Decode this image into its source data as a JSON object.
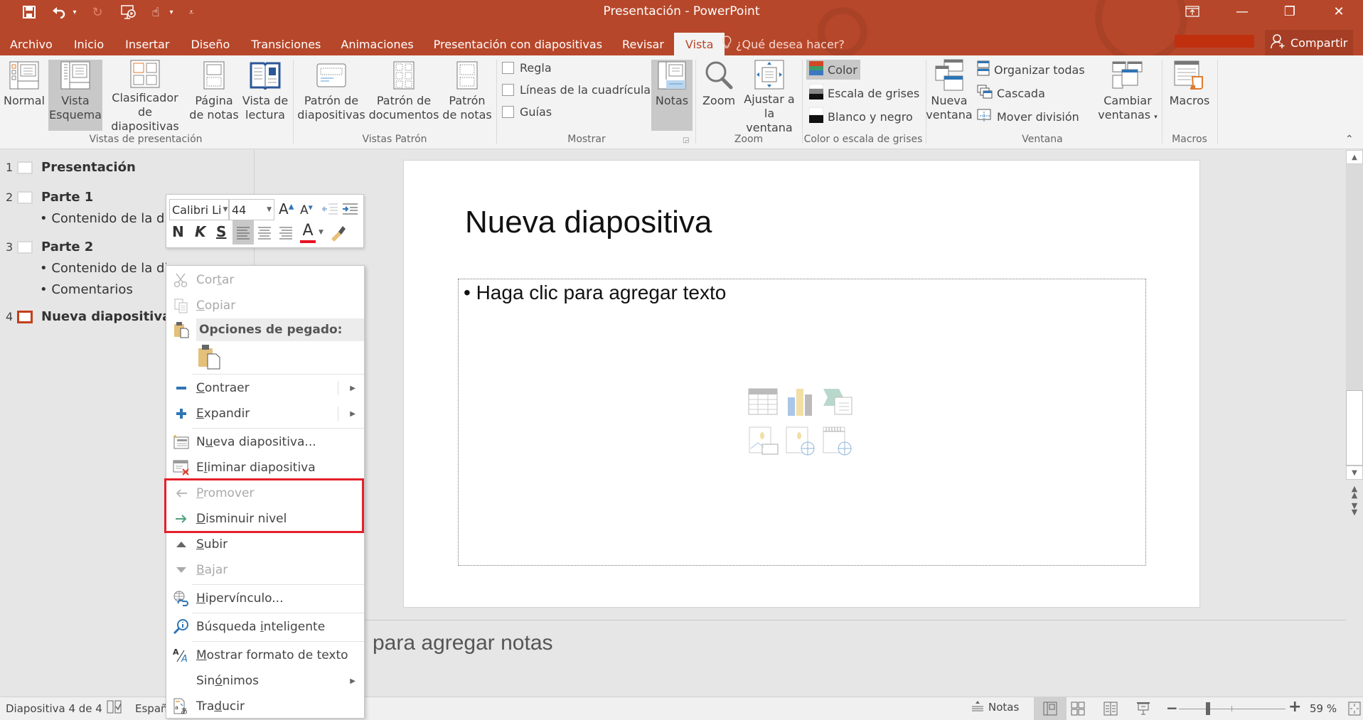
{
  "window": {
    "title": "Presentación - PowerPoint",
    "controls": {
      "ribbon_display": "ribbon-display-icon",
      "minimize": "—",
      "restore": "❐",
      "close": "✕"
    }
  },
  "quick_access": [
    {
      "name": "save-icon",
      "glyph": "💾"
    },
    {
      "name": "undo-icon",
      "glyph": "↶"
    },
    {
      "name": "undo-dropdown",
      "glyph": "▾"
    },
    {
      "name": "redo-icon",
      "glyph": "↻"
    },
    {
      "name": "present-from-start-icon",
      "glyph": "▶"
    },
    {
      "name": "touch-mode-icon",
      "glyph": "☝"
    },
    {
      "name": "touch-dropdown",
      "glyph": "▾"
    },
    {
      "name": "customize-qat",
      "glyph": "⩡"
    }
  ],
  "tabs": [
    "Archivo",
    "Inicio",
    "Insertar",
    "Diseño",
    "Transiciones",
    "Animaciones",
    "Presentación con diapositivas",
    "Revisar",
    "Vista"
  ],
  "active_tab": "Vista",
  "tell_me": "¿Qué desea hacer?",
  "share": "Compartir",
  "ribbon": {
    "presentation_views": {
      "label": "Vistas de presentación",
      "buttons": [
        {
          "l1": "Normal",
          "l2": ""
        },
        {
          "l1": "Vista",
          "l2": "Esquema",
          "selected": true
        },
        {
          "l1": "Clasificador de",
          "l2": "diapositivas"
        },
        {
          "l1": "Página",
          "l2": "de notas"
        },
        {
          "l1": "Vista de",
          "l2": "lectura"
        }
      ]
    },
    "master_views": {
      "label": "Vistas Patrón",
      "buttons": [
        {
          "l1": "Patrón de",
          "l2": "diapositivas"
        },
        {
          "l1": "Patrón de",
          "l2": "documentos"
        },
        {
          "l1": "Patrón",
          "l2": "de notas"
        }
      ]
    },
    "show": {
      "label": "Mostrar",
      "checkboxes": [
        {
          "label": "Regla",
          "checked": false
        },
        {
          "label": "Líneas de la cuadrícula",
          "checked": false
        },
        {
          "label": "Guías",
          "checked": false
        }
      ],
      "notes": "Notas"
    },
    "zoom": {
      "label": "Zoom",
      "zoom": "Zoom",
      "fit_l1": "Ajustar a",
      "fit_l2": "la ventana"
    },
    "color": {
      "label": "Color o escala de grises",
      "options": [
        "Color",
        "Escala de grises",
        "Blanco y negro"
      ],
      "selected": "Color"
    },
    "window": {
      "label": "Ventana",
      "new_l1": "Nueva",
      "new_l2": "ventana",
      "small": [
        "Organizar todas",
        "Cascada",
        "Mover división"
      ],
      "switch_l1": "Cambiar",
      "switch_l2": "ventanas"
    },
    "macros": {
      "label": "Macros",
      "button": "Macros"
    }
  },
  "outline": {
    "slides": [
      {
        "num": "1",
        "title": "Presentación",
        "bullets": []
      },
      {
        "num": "2",
        "title": "Parte 1",
        "bullets": [
          "• Contenido de la diapositiva"
        ]
      },
      {
        "num": "3",
        "title": "Parte 2",
        "bullets": [
          "• Contenido de la diapositiva",
          "• Comentarios"
        ]
      },
      {
        "num": "4",
        "title": "Nueva diapositiva",
        "bullets": [],
        "current": true
      }
    ]
  },
  "slide": {
    "title": "Nueva diapositiva",
    "content_placeholder": "• Haga clic para agregar texto"
  },
  "notes_placeholder": "Haga clic para agregar notas",
  "notes_visible_text": "para agregar notas",
  "mini_toolbar": {
    "font": "Calibri Li",
    "size": "44",
    "bold": "N",
    "italic": "K",
    "shadow": "S",
    "font_color": "#e81123"
  },
  "context_menu": {
    "items": [
      {
        "label": "Cortar",
        "u": 3,
        "disabled": true,
        "icon": "scissors-icon"
      },
      {
        "label": "Copiar",
        "u": 0,
        "disabled": true,
        "icon": "copy-icon"
      },
      {
        "label": "Opciones de pegado:",
        "header": true,
        "icon": "paste-icon"
      },
      {
        "label": "Contraer",
        "u": 0,
        "submenu": true,
        "icon": "minus-icon"
      },
      {
        "label": "Expandir",
        "u": 0,
        "submenu": true,
        "icon": "plus-icon"
      },
      {
        "label": "Nueva diapositiva...",
        "u": 1,
        "icon": "new-slide-icon"
      },
      {
        "label": "Eliminar diapositiva",
        "u": 1,
        "icon": "delete-slide-icon"
      },
      {
        "label": "Promover",
        "u": 0,
        "disabled": true,
        "icon": "arrow-left-icon"
      },
      {
        "label": "Disminuir nivel",
        "u": 0,
        "icon": "arrow-right-icon"
      },
      {
        "label": "Subir",
        "u": 0,
        "icon": "triangle-up-icon"
      },
      {
        "label": "Bajar",
        "u": 0,
        "disabled": true,
        "icon": "triangle-down-icon"
      },
      {
        "label": "Hipervínculo...",
        "u": 0,
        "icon": "hyperlink-icon"
      },
      {
        "label": "Búsqueda inteligente",
        "u": 10,
        "icon": "smart-lookup-icon"
      },
      {
        "label": "Mostrar formato de texto",
        "u": 0,
        "icon": "text-format-icon"
      },
      {
        "label": "Sinónimos",
        "u": 3,
        "submenu": true,
        "icon": ""
      },
      {
        "label": "Traducir",
        "u": 4,
        "icon": "translate-icon"
      }
    ],
    "highlight_color": "#e4202a"
  },
  "status": {
    "slide_info": "Diapositiva 4 de 4",
    "language": "Español",
    "notes": "Notas",
    "zoom_percent": "59 %",
    "zoom_value": 59
  },
  "colors": {
    "accent": "#b7472a",
    "ribbon_bg": "#f3f3f3",
    "selected": "#c8c8c8"
  }
}
